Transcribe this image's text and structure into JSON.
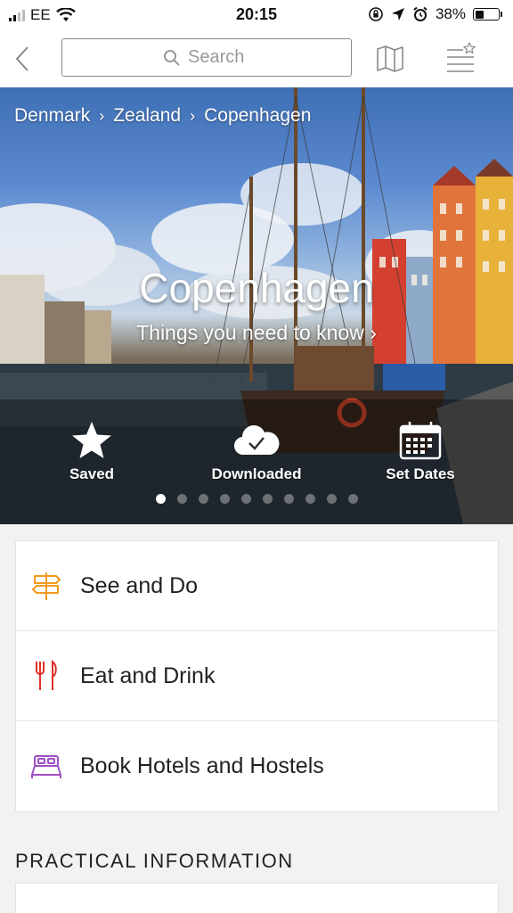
{
  "status_bar": {
    "carrier": "EE",
    "time": "20:15",
    "battery_percent": "38%",
    "battery_level": 0.38
  },
  "nav": {
    "search_placeholder": "Search",
    "icons": [
      "chevron-left-icon",
      "search-icon",
      "map-icon",
      "list-star-icon"
    ]
  },
  "hero": {
    "breadcrumb": [
      "Denmark",
      "Zealand",
      "Copenhagen"
    ],
    "title": "Copenhagen",
    "subtitle": "Things you need to know ›",
    "actions": [
      {
        "label": "Saved",
        "icon": "star-icon"
      },
      {
        "label": "Downloaded",
        "icon": "cloud-check-icon"
      },
      {
        "label": "Set Dates",
        "icon": "calendar-icon"
      }
    ],
    "page_count": 10,
    "active_page": 1
  },
  "menu": [
    {
      "label": "See and Do",
      "icon": "signpost-icon",
      "color": "#f39a1e"
    },
    {
      "label": "Eat and Drink",
      "icon": "fork-knife-icon",
      "color": "#e0302a"
    },
    {
      "label": "Book Hotels and Hostels",
      "icon": "bed-icon",
      "color": "#a04fc4"
    }
  ],
  "section": {
    "practical_information": "PRACTICAL INFORMATION"
  }
}
